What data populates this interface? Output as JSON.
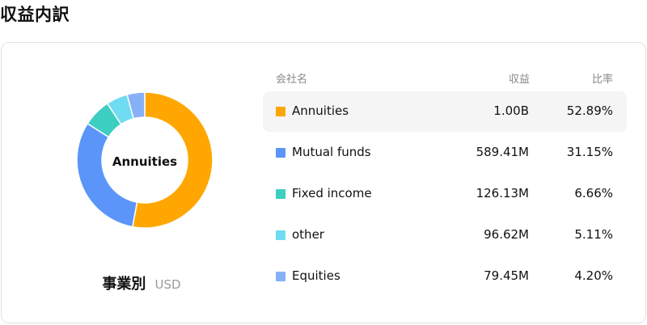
{
  "title": "収益内訳",
  "segment": {
    "title": "事業別",
    "currency": "USD"
  },
  "table": {
    "headers": {
      "name": "会社名",
      "revenue": "収益",
      "ratio": "比率"
    },
    "rows": [
      {
        "name": "Annuities",
        "revenue": "1.00B",
        "ratio": "52.89%",
        "color": "#ffa600",
        "active": true
      },
      {
        "name": "Mutual funds",
        "revenue": "589.41M",
        "ratio": "31.15%",
        "color": "#5b95f9"
      },
      {
        "name": "Fixed income",
        "revenue": "126.13M",
        "ratio": "6.66%",
        "color": "#3ccec0"
      },
      {
        "name": "other",
        "revenue": "96.62M",
        "ratio": "5.11%",
        "color": "#6fdcf2"
      },
      {
        "name": "Equities",
        "revenue": "79.45M",
        "ratio": "4.20%",
        "color": "#86b1f7"
      }
    ]
  },
  "chart_data": {
    "type": "pie",
    "center_label": "Annuities",
    "categories": [
      "Annuities",
      "Mutual funds",
      "Fixed income",
      "other",
      "Equities"
    ],
    "values": [
      52.89,
      31.15,
      6.66,
      5.11,
      4.2
    ],
    "colors": [
      "#ffa600",
      "#5b95f9",
      "#3ccec0",
      "#6fdcf2",
      "#86b1f7"
    ]
  }
}
